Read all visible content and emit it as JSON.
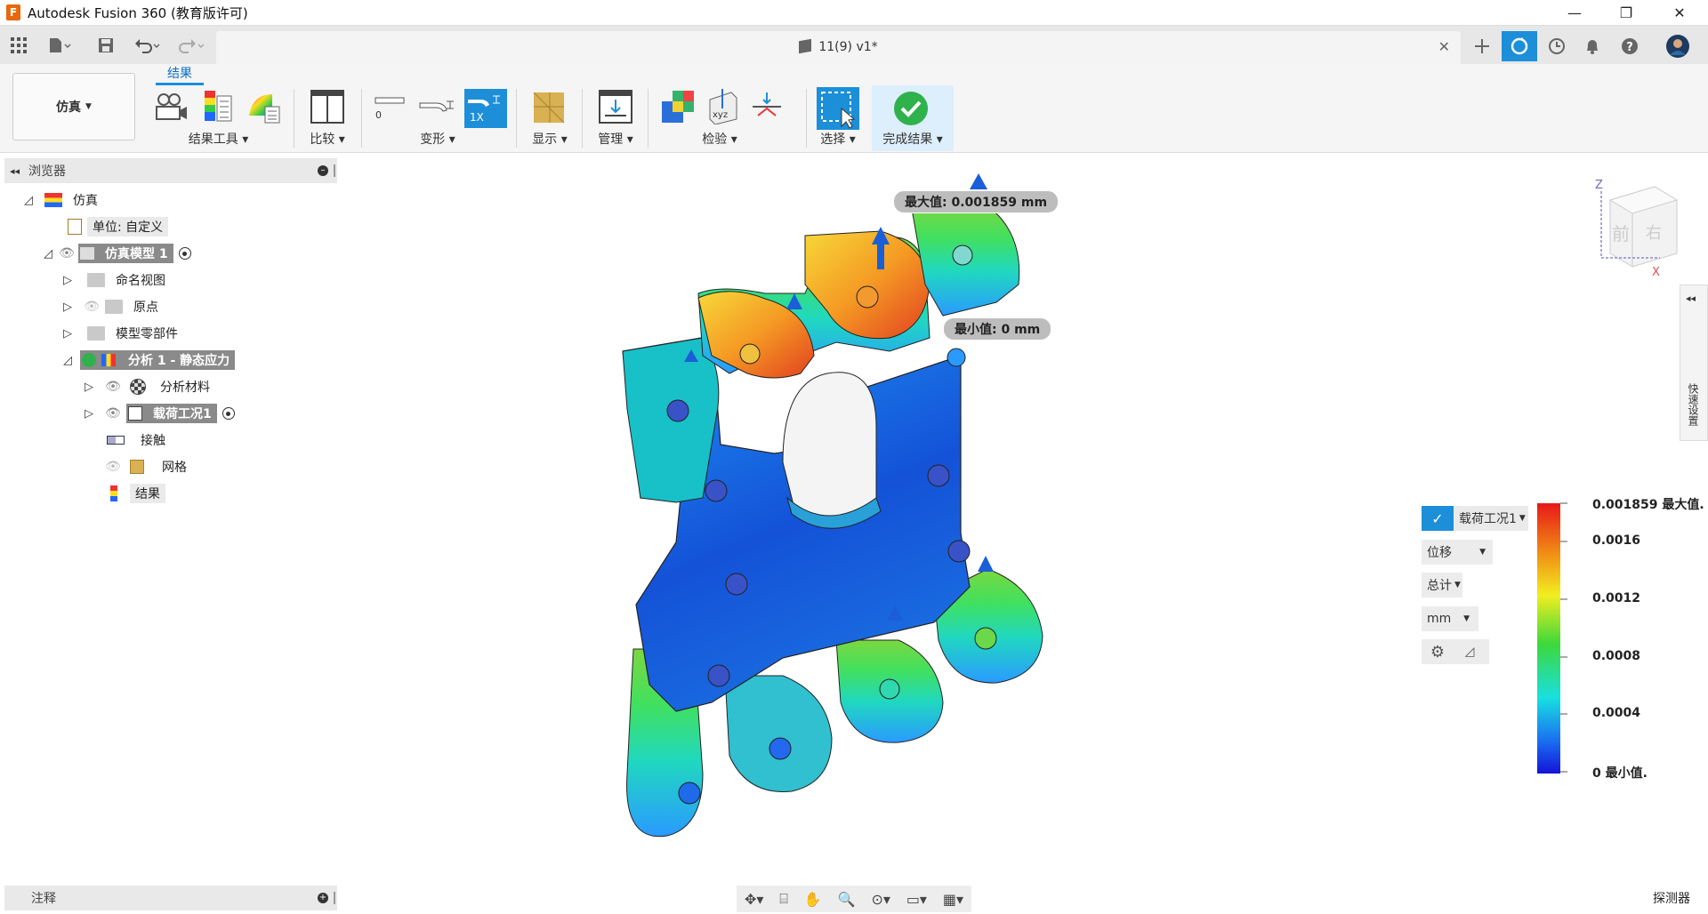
{
  "window": {
    "title": "Autodesk Fusion 360 (教育版许可)",
    "doc_title": "11(9) v1*",
    "icons": [
      "grid-icon",
      "file-icon",
      "save-icon",
      "undo-icon",
      "redo-icon",
      "close-icon",
      "plus-icon",
      "sync-icon",
      "clock-icon",
      "bell-icon",
      "help-icon",
      "avatar"
    ]
  },
  "ribbon": {
    "workspace": "仿真",
    "tab": "结果",
    "groups": {
      "result_tools": "结果工具",
      "compare": "比较",
      "deform": "变形",
      "display": "显示",
      "manage": "管理",
      "inspect": "检验",
      "select": "选择",
      "finish": "完成结果"
    },
    "deform_zero": "0",
    "deform_scale": "1X"
  },
  "browser": {
    "title": "浏览器",
    "items": [
      {
        "label": "仿真"
      },
      {
        "label": "单位: 自定义"
      },
      {
        "label": "仿真模型 1"
      },
      {
        "label": "命名视图"
      },
      {
        "label": "原点"
      },
      {
        "label": "模型零部件"
      },
      {
        "label": "分析 1 - 静态应力"
      },
      {
        "label": "分析材料"
      },
      {
        "label": "载荷工况1"
      },
      {
        "label": "接触"
      },
      {
        "label": "网格"
      },
      {
        "label": "结果"
      }
    ]
  },
  "viewport": {
    "max_tooltip": "最大值: 0.001859 mm",
    "min_tooltip": "最小值: 0 mm",
    "viewcube_front": "前",
    "viewcube_right": "右",
    "axis_z": "Z",
    "axis_x": "X",
    "right_panel": "快速设置"
  },
  "legend": {
    "load_case": "载荷工况1",
    "result_type": "位移",
    "component": "总计",
    "unit": "mm",
    "ticks": [
      "0.001859 最大值.",
      "0.0016",
      "0.0012",
      "0.0008",
      "0.0004",
      "0 最小值."
    ]
  },
  "bottom": {
    "annotations": "注释",
    "probe": "探测器"
  }
}
